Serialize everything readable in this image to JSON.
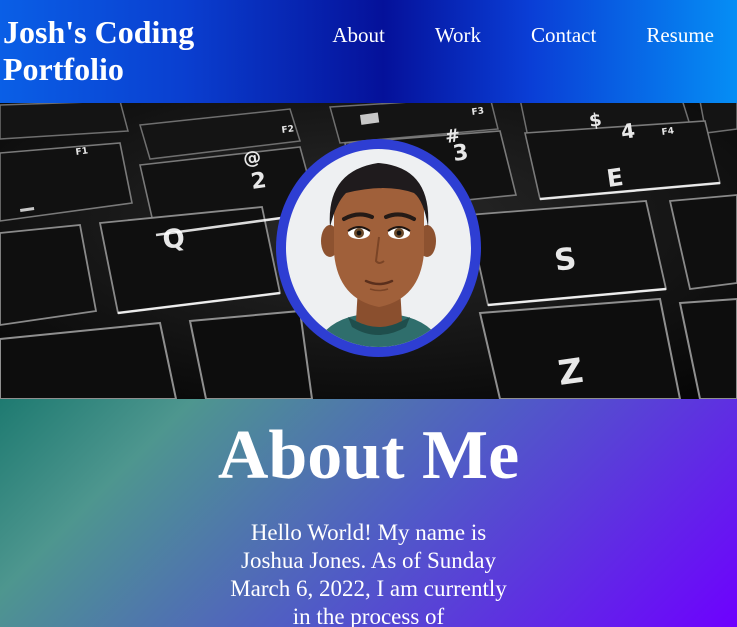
{
  "header": {
    "site_title": "Josh's Coding Portfolio",
    "nav": [
      {
        "label": "About"
      },
      {
        "label": "Work"
      },
      {
        "label": "Contact"
      },
      {
        "label": "Resume"
      }
    ]
  },
  "hero": {
    "background_image": "keyboard-closeup",
    "avatar": "cartoon-portrait",
    "key_glyphs": [
      "@",
      "2",
      "#",
      "3",
      "$",
      "4",
      "E",
      "Q",
      "S",
      "Z",
      "F1",
      "F2",
      "F3",
      "F4"
    ]
  },
  "about": {
    "heading": "About Me",
    "intro": "Hello World! My name is Joshua Jones. As of Sunday March 6, 2022, I am currently in the process of"
  },
  "colors": {
    "header_gradient": [
      "#0a5fe6",
      "#05119a",
      "#058ef5"
    ],
    "avatar_ring": "#2e3ed3",
    "about_gradient": [
      "#127369",
      "#323cbe",
      "#6e00ff"
    ]
  }
}
